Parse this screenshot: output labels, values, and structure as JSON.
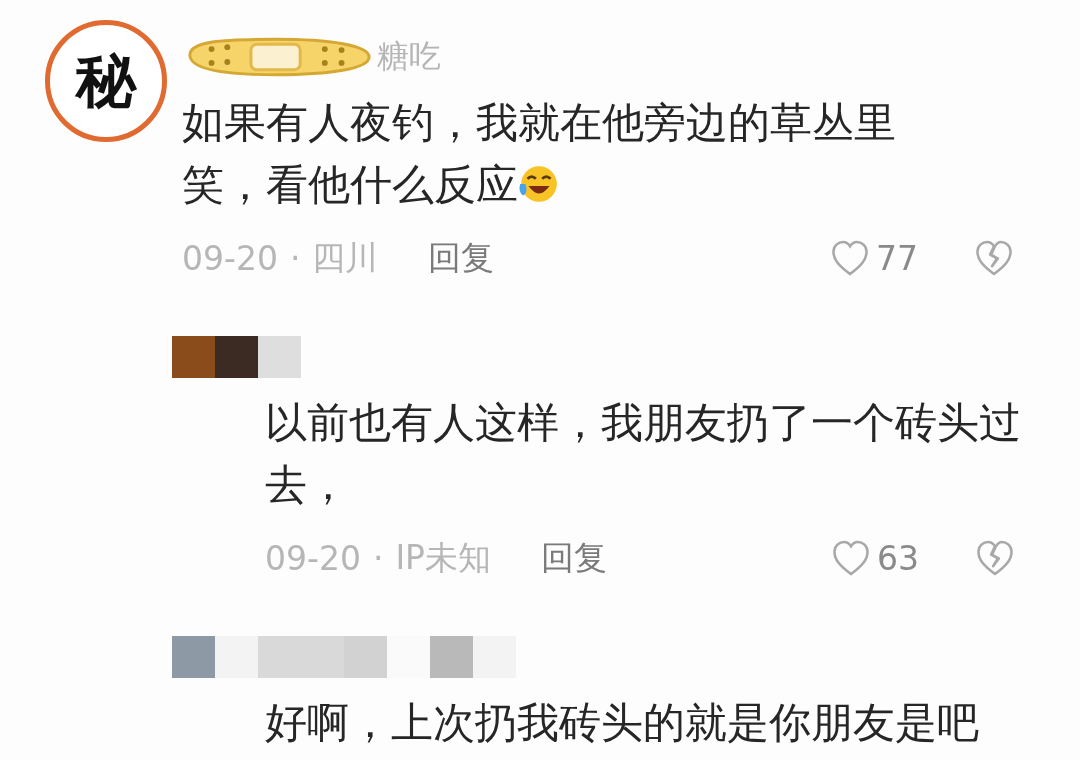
{
  "comments": [
    {
      "kind": "top",
      "avatar": "秘",
      "username": "糖吃",
      "text": "如果有人夜钓，我就在他旁边的草丛里笑，看他什么反应",
      "emoji": true,
      "date": "09-20",
      "separator": "·",
      "location": "四川",
      "reply": "回复",
      "likes": "77"
    },
    {
      "kind": "reply",
      "text": "以前也有人这样，我朋友扔了一个砖头过去，",
      "date": "09-20",
      "separator": "·",
      "location": "IP未知",
      "reply": "回复",
      "likes": "63"
    },
    {
      "kind": "reply",
      "text": "好啊，上次扔我砖头的就是你朋友是吧"
    }
  ]
}
